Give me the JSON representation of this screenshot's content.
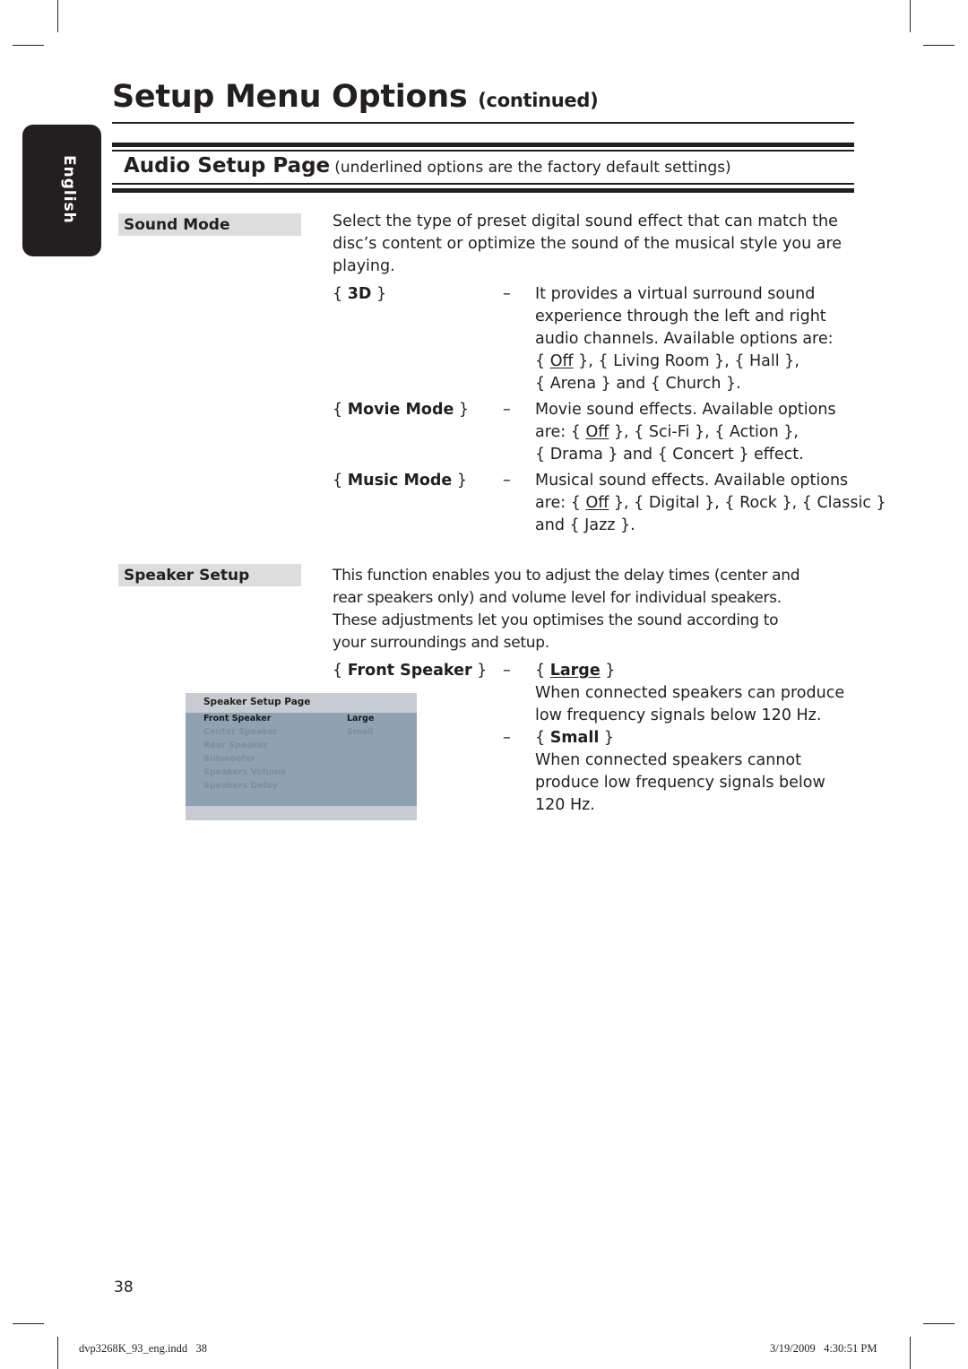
{
  "header": {
    "title": "Setup Menu Options",
    "title_suffix": "(continued)"
  },
  "language_tab": "English",
  "section": {
    "title": "Audio Setup Page",
    "subtitle": "(underlined options are the factory default settings)"
  },
  "sound_mode": {
    "label": "Sound Mode",
    "description_lines": [
      "Select the type of preset digital sound effect that can match the",
      "disc’s content or optimize the sound of the musical style you are",
      "playing."
    ],
    "options": [
      {
        "key_open": "{ ",
        "key": "3D",
        "key_close": " }",
        "dash": "–",
        "lines": [
          "It provides a virtual surround sound",
          "experience through the left and right",
          "audio channels. Available options are:"
        ],
        "choices_line1": {
          "pre": "{ ",
          "default": "Off",
          "post": " }, { Living Room }, { Hall },"
        },
        "choices_line2": "{ Arena } and { Church }."
      },
      {
        "key_open": "{ ",
        "key": "Movie Mode",
        "key_close": " }",
        "dash": "–",
        "lines": [
          "Movie sound effects. Available options"
        ],
        "choices_line1": {
          "pre": "are: { ",
          "default": "Off",
          "post": " }, { Sci-Fi }, { Action },"
        },
        "choices_line2": "{ Drama } and { Concert } effect."
      },
      {
        "key_open": "{ ",
        "key": "Music Mode",
        "key_close": " }",
        "dash": "–",
        "lines": [
          "Musical sound effects. Available options"
        ],
        "choices_line1": {
          "pre": "are: { ",
          "default": "Off",
          "post": " }, { Digital }, { Rock }, { Classic }"
        },
        "choices_line2": "and { Jazz }."
      }
    ]
  },
  "speaker_setup": {
    "label": "Speaker Setup",
    "description_lines": [
      "This function enables you to adjust the delay times (center and",
      "rear speakers only) and volume level for individual speakers.",
      "These adjustments let you optimises the sound according to",
      "your surroundings and setup."
    ],
    "front_speaker": {
      "key_open": "{ ",
      "key": "Front Speaker",
      "key_close": " }",
      "options": [
        {
          "dash": "–",
          "open": "{ ",
          "name": "Large",
          "close": " }",
          "is_default": true,
          "lines": [
            "When connected speakers can produce",
            "low frequency signals below 120 Hz."
          ]
        },
        {
          "dash": "–",
          "open": "{ ",
          "name": "Small",
          "close": " }",
          "is_default": false,
          "lines": [
            "When connected speakers cannot",
            "produce low frequency signals below",
            "120 Hz."
          ]
        }
      ]
    },
    "osd": {
      "title": "Speaker Setup Page",
      "items": [
        "Front Speaker",
        "Center Speaker",
        "Rear Speaker",
        "Subwoofer",
        "Speakers Volume",
        "Speakers Delay"
      ],
      "active_item": "Front Speaker",
      "values": [
        "Large",
        "Small"
      ],
      "active_value": "Large",
      "colors": {
        "panel": "#8fa2b2",
        "header": "#c6ccd1",
        "inactive_text": "#7d8f9e"
      }
    }
  },
  "footer": {
    "page_number": "38",
    "file": "dvp3268K_93_eng.indd   38",
    "timestamp": "3/19/2009   4:30:51 PM"
  },
  "colors": {
    "text": "#231f20",
    "label_bg": "#dcdddf"
  }
}
